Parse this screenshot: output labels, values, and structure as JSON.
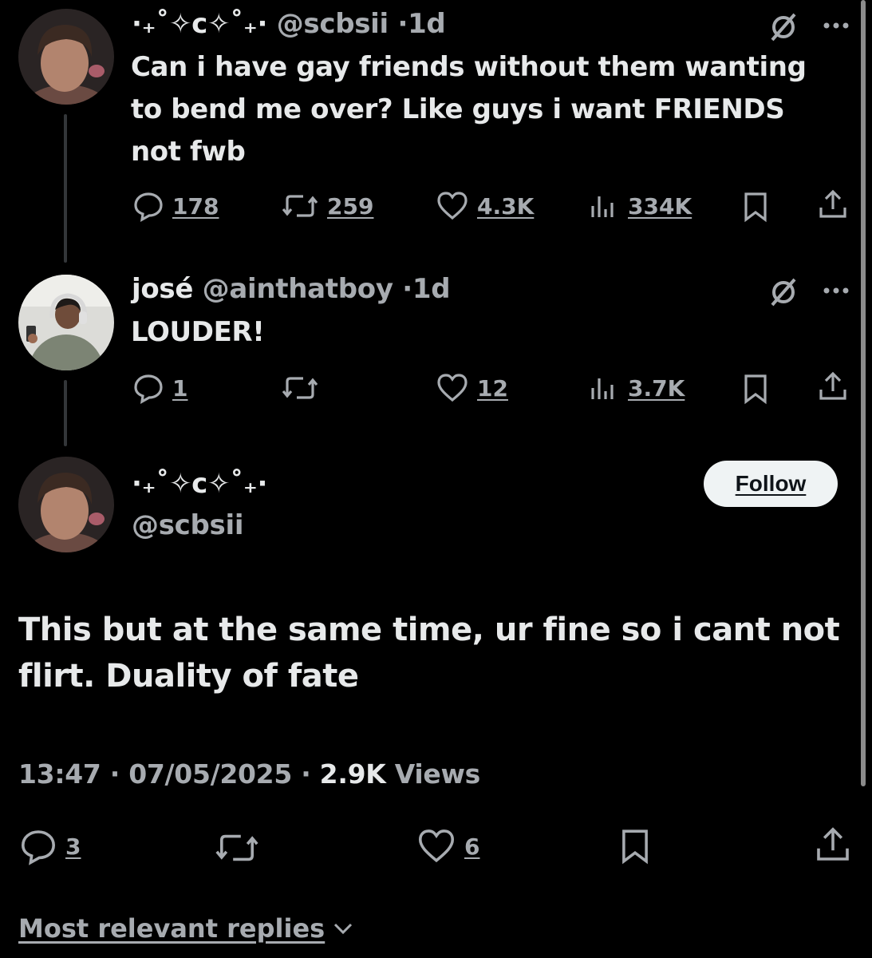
{
  "tweet1": {
    "display_name": "·₊˚✧c✧˚₊·",
    "handle": "@scbsii",
    "sep": "·",
    "time": "1d",
    "lines": [
      "Can i have gay friends without them wanting",
      "to bend me over? Like guys i want FRIENDS",
      "not fwb"
    ],
    "replies": "178",
    "reposts": "259",
    "likes": "4.3K",
    "views": "334K"
  },
  "tweet2": {
    "display_name": "josé",
    "handle": "@ainthatboy",
    "sep": "·",
    "time": "1d",
    "text": "LOUDER!",
    "replies": "1",
    "likes": "12",
    "views": "3.7K"
  },
  "main": {
    "display_name": "·₊˚✧c✧˚₊·",
    "handle": "@scbsii",
    "follow_label": "Follow",
    "lines": [
      "This but at the same time, ur fine so i cant not",
      "flirt. Duality of fate"
    ],
    "time": "13:47",
    "date": "07/05/2025",
    "views_count": "2.9K",
    "views_label": "Views",
    "replies": "3",
    "likes": "6"
  },
  "replies_sort_label": "Most relevant replies",
  "icons": {
    "reply": "reply-icon",
    "repost": "repost-icon",
    "like": "heart-icon",
    "views": "views-icon",
    "bookmark": "bookmark-icon",
    "share": "share-icon",
    "grok": "grok-icon",
    "more": "more-icon",
    "chevron": "chevron-down-icon"
  },
  "colors": {
    "background": "#000000",
    "text": "#e7e9ea",
    "muted": "#a7abb0",
    "button": "#eff3f4"
  }
}
